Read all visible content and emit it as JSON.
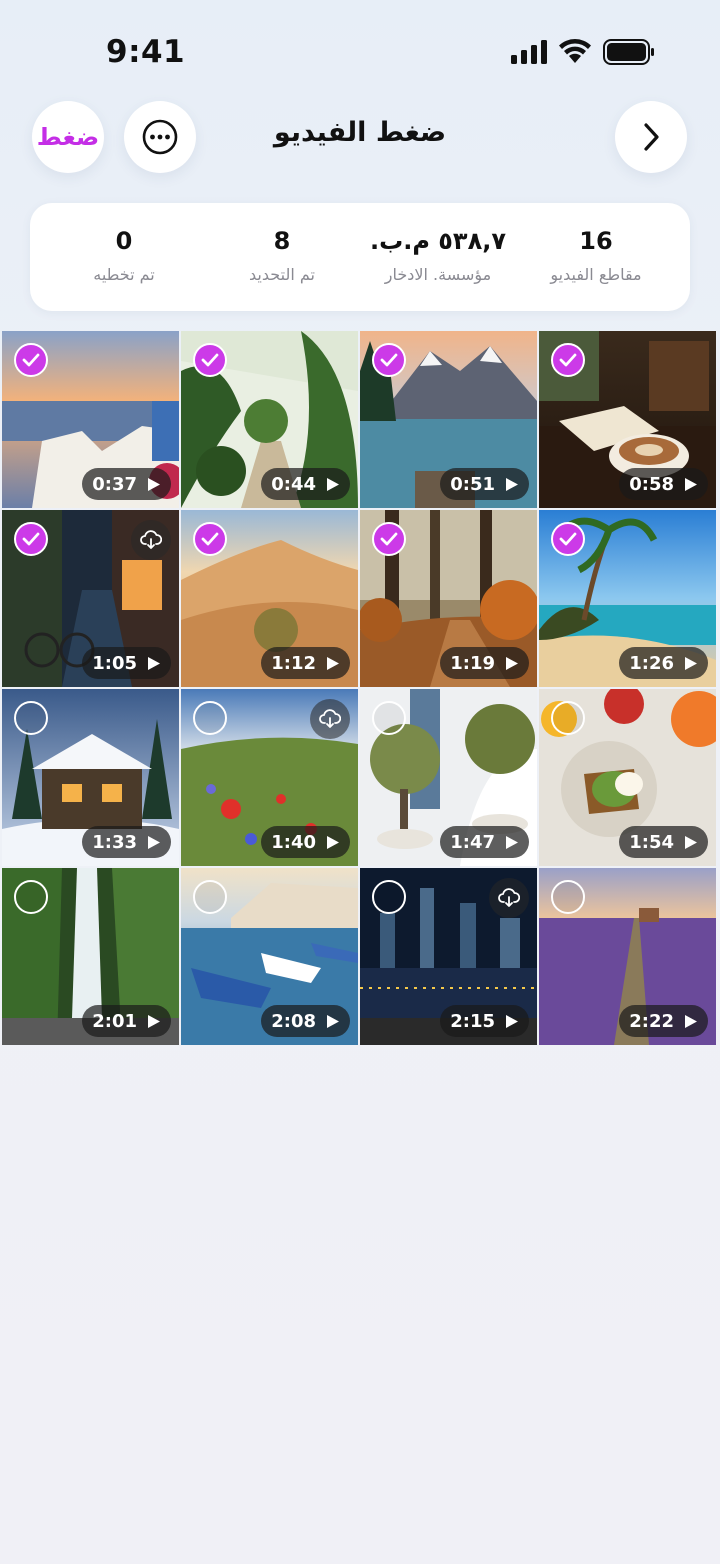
{
  "status": {
    "time": "9:41"
  },
  "header": {
    "compress_label": "ضغط",
    "title": "ضغط الفيديو"
  },
  "stats": [
    {
      "value": "16",
      "label": "مقاطع الفيديو"
    },
    {
      "value": "٥٣٨,٧ م.ب.",
      "label": "مؤسسة. الادخار"
    },
    {
      "value": "8",
      "label": "تم التحديد"
    },
    {
      "value": "0",
      "label": "تم تخطيه"
    }
  ],
  "colors": {
    "accent": "#cc3ae8",
    "background": "#eef1f7"
  },
  "icons": {
    "more": "ellipsis-circle-icon",
    "back": "chevron-right-icon",
    "cloud": "cloud-download-icon",
    "play": "play-icon",
    "check": "checkmark-icon"
  },
  "videos": [
    {
      "scene": "coffee-book",
      "duration": "0:58",
      "selected": true,
      "cloud": false
    },
    {
      "scene": "mountain-lake",
      "duration": "0:51",
      "selected": true,
      "cloud": false
    },
    {
      "scene": "greenhouse",
      "duration": "0:44",
      "selected": true,
      "cloud": false
    },
    {
      "scene": "santorini-sunset",
      "duration": "0:37",
      "selected": true,
      "cloud": false
    },
    {
      "scene": "tropical-beach",
      "duration": "1:26",
      "selected": true,
      "cloud": false
    },
    {
      "scene": "autumn-forest",
      "duration": "1:19",
      "selected": true,
      "cloud": false
    },
    {
      "scene": "desert-dunes",
      "duration": "1:12",
      "selected": true,
      "cloud": false
    },
    {
      "scene": "rainy-street",
      "duration": "1:05",
      "selected": true,
      "cloud": true
    },
    {
      "scene": "breakfast-table",
      "duration": "1:54",
      "selected": false,
      "cloud": false
    },
    {
      "scene": "olive-atrium",
      "duration": "1:47",
      "selected": false,
      "cloud": false
    },
    {
      "scene": "poppy-meadow",
      "duration": "1:40",
      "selected": false,
      "cloud": true
    },
    {
      "scene": "snowy-cabin",
      "duration": "1:33",
      "selected": false,
      "cloud": false
    },
    {
      "scene": "lavender-field",
      "duration": "2:22",
      "selected": false,
      "cloud": false
    },
    {
      "scene": "city-night",
      "duration": "2:15",
      "selected": false,
      "cloud": true
    },
    {
      "scene": "harbor-boats",
      "duration": "2:08",
      "selected": false,
      "cloud": false
    },
    {
      "scene": "waterfall",
      "duration": "2:01",
      "selected": false,
      "cloud": false
    }
  ]
}
